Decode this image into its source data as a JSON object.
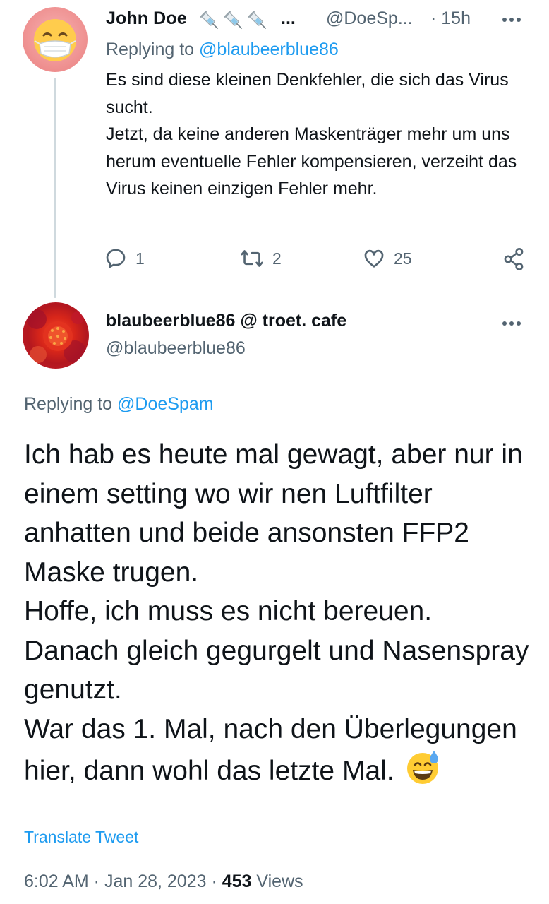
{
  "parent_tweet": {
    "author_name": "John Doe",
    "name_ellipsis": "...",
    "handle": "@DoeSp...",
    "time": "· 15h",
    "replying_prefix": "Replying to ",
    "replying_handle": "@blaubeerblue86",
    "text": "Es sind diese kleinen Denkfehler, die sich das Virus sucht.\nJetzt, da keine anderen Maskenträger mehr um uns herum eventuelle Fehler kompensieren, verzeiht das Virus keinen einzigen Fehler mehr.",
    "replies": "1",
    "retweets": "2",
    "likes": "25"
  },
  "main_tweet": {
    "author_name": "blaubeerblue86 @ troet. cafe",
    "handle": "@blaubeerblue86",
    "replying_prefix": "Replying to ",
    "replying_handle": "@DoeSpam",
    "text": "Ich hab es heute mal gewagt, aber nur in einem setting wo wir nen Luftfilter anhatten und beide ansonsten FFP2 Maske trugen.\nHoffe, ich muss es nicht bereuen.\nDanach gleich gegurgelt und Nasenspray genutzt.\nWar das 1. Mal, nach den Überlegungen hier, dann wohl das letzte Mal.",
    "translate_label": "Translate Tweet",
    "timestamp": "6:02 AM · Jan 28, 2023 · ",
    "views_count": "453",
    "views_label": " Views"
  },
  "icons": {
    "reply": "reply-icon",
    "retweet": "retweet-icon",
    "like": "heart-icon",
    "share": "share-icon",
    "more": "more-dots-icon",
    "syringe": "syringe-icon",
    "emoji": "grinning-sweat-emoji"
  },
  "colors": {
    "link": "#1d9bf0",
    "secondary_text": "#536471",
    "primary_text": "#0f1419",
    "thread_line": "#cfd9de"
  }
}
